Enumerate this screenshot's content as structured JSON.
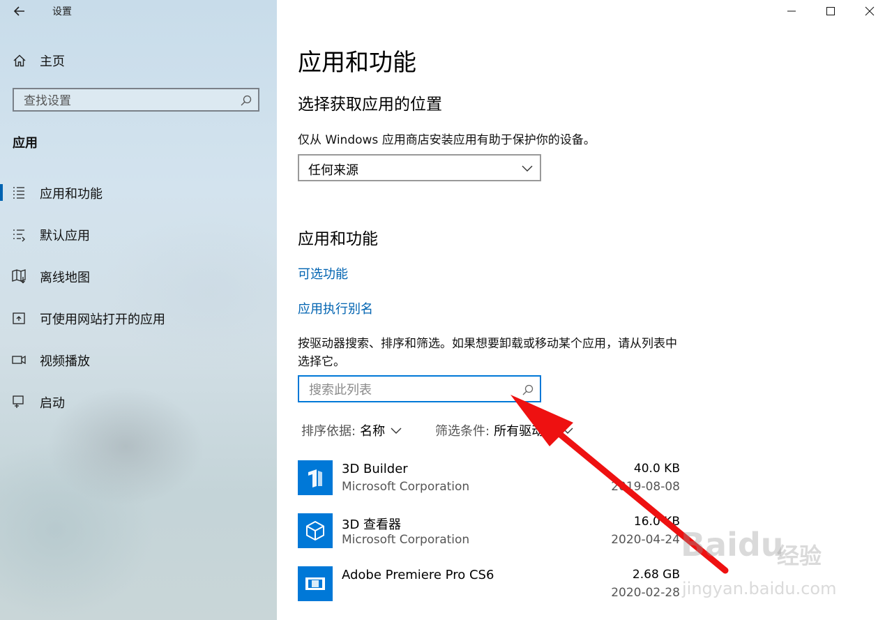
{
  "window": {
    "title": "设置",
    "controls": [
      "minimize-icon",
      "maximize-icon",
      "close-icon"
    ]
  },
  "sidebar": {
    "home_label": "主页",
    "search_placeholder": "查找设置",
    "section_label": "应用",
    "items": [
      {
        "label": "应用和功能",
        "icon": "apps-list-icon",
        "selected": true
      },
      {
        "label": "默认应用",
        "icon": "default-apps-icon",
        "selected": false
      },
      {
        "label": "离线地图",
        "icon": "map-icon",
        "selected": false
      },
      {
        "label": "可使用网站打开的应用",
        "icon": "open-website-icon",
        "selected": false
      },
      {
        "label": "视频播放",
        "icon": "video-icon",
        "selected": false
      },
      {
        "label": "启动",
        "icon": "startup-icon",
        "selected": false
      }
    ]
  },
  "main": {
    "page_title": "应用和功能",
    "install_section": {
      "heading": "选择获取应用的位置",
      "description": "仅从 Windows 应用商店安装应用有助于保护你的设备。",
      "dropdown_value": "任何来源"
    },
    "apps_section": {
      "heading": "应用和功能",
      "links": [
        "可选功能",
        "应用执行别名"
      ],
      "help_text": "按驱动器搜索、排序和筛选。如果想要卸载或移动某个应用，请从列表中选择它。",
      "search_placeholder": "搜索此列表",
      "sort_label": "排序依据:",
      "sort_value": "名称",
      "filter_label": "筛选条件:",
      "filter_value": "所有驱动器"
    },
    "apps": [
      {
        "name": "3D Builder",
        "publisher": "Microsoft Corporation",
        "size": "40.0 KB",
        "date": "2019-08-08",
        "icon": "3d-builder-icon"
      },
      {
        "name": "3D 查看器",
        "publisher": "Microsoft Corporation",
        "size": "16.0 KB",
        "date": "2020-04-24",
        "icon": "3d-viewer-icon"
      },
      {
        "name": "Adobe Premiere Pro CS6",
        "publisher": "",
        "size": "2.68 GB",
        "date": "2020-02-28",
        "icon": "premiere-icon"
      }
    ]
  },
  "watermark": {
    "logo": "Baidu",
    "logo_cn": "经验",
    "url": "jingyan.baidu.com"
  },
  "colors": {
    "accent": "#0078d7",
    "link": "#0063b1",
    "annotation_arrow": "#ee1111"
  }
}
